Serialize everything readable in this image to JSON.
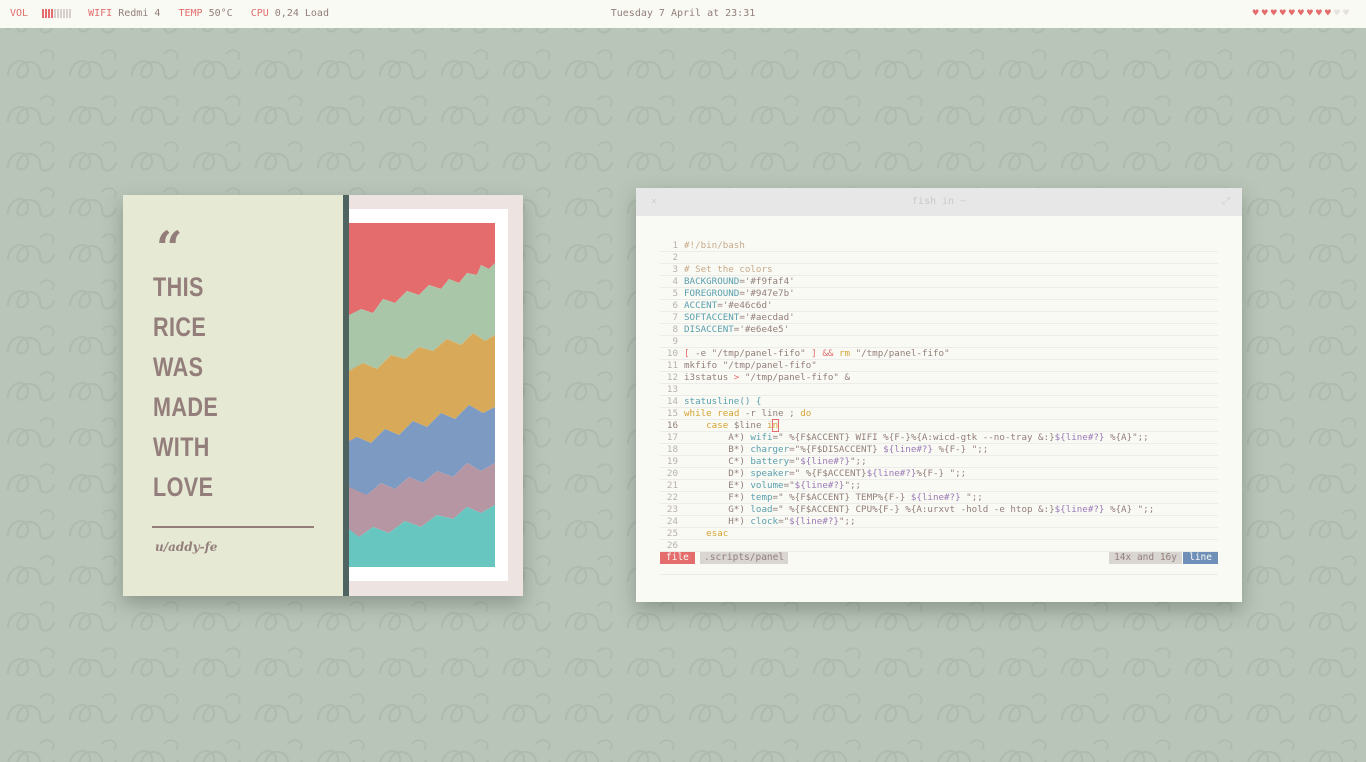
{
  "topbar": {
    "vol_label": "VOL",
    "volume_level": 0.4,
    "wifi_label": "WIFI",
    "wifi_value": "Redmi 4",
    "temp_label": "TEMP",
    "temp_value": "50°C",
    "cpu_label": "CPU",
    "cpu_value": "0,24 Load",
    "clock": "Tuesday 7 April at 23:31",
    "hearts_filled": 9,
    "hearts_total": 11,
    "heart_glyph": "♥"
  },
  "card": {
    "quote_glyph": "“",
    "words": [
      "THIS",
      "RICE",
      "WAS",
      "MADE",
      "WITH",
      "LOVE"
    ],
    "signature": "u/addy-fe",
    "stripe_colors": [
      "#e46c6d",
      "#a9c7a8",
      "#d9a95a",
      "#7c9ac2",
      "#b596a2",
      "#68c6c0"
    ]
  },
  "terminal": {
    "title": "fish in ~",
    "close_glyph": "✕",
    "maximize_glyph": "⤢",
    "lines": [
      {
        "n": "1",
        "t": "#!/bin/bash"
      },
      {
        "n": "2",
        "t": ""
      },
      {
        "n": "3",
        "t": "# Set the colors"
      },
      {
        "n": "4",
        "t": "BACKGROUND='#f9faf4'"
      },
      {
        "n": "5",
        "t": "FOREGROUND='#947e7b'"
      },
      {
        "n": "6",
        "t": "ACCENT='#e46c6d'"
      },
      {
        "n": "7",
        "t": "SOFTACCENT='#aecdad'"
      },
      {
        "n": "8",
        "t": "DISACCENT='#e6e4e5'"
      },
      {
        "n": "9",
        "t": ""
      },
      {
        "n": "10",
        "t": "[ -e \"/tmp/panel-fifo\" ] && rm \"/tmp/panel-fifo\""
      },
      {
        "n": "11",
        "t": "mkfifo \"/tmp/panel-fifo\""
      },
      {
        "n": "12",
        "t": "i3status > \"/tmp/panel-fifo\" &"
      },
      {
        "n": "13",
        "t": ""
      },
      {
        "n": "14",
        "t": "statusline() {"
      },
      {
        "n": "15",
        "t": "while read -r line ; do"
      },
      {
        "n": "16",
        "t": "    case $line in"
      },
      {
        "n": "17",
        "t": "        A*) wifi=\" %{F$ACCENT} WIFI %{F-}%{A:wicd-gtk --no-tray &:}${line#?} %{A}\";;"
      },
      {
        "n": "18",
        "t": "        B*) charger=\"%{F$DISACCENT} ${line#?} %{F-} \";;"
      },
      {
        "n": "19",
        "t": "        C*) battery=\"${line#?}\";;"
      },
      {
        "n": "20",
        "t": "        D*) speaker=\" %{F$ACCENT}${line#?}%{F-} \";;"
      },
      {
        "n": "21",
        "t": "        E*) volume=\"${line#?}\";;"
      },
      {
        "n": "22",
        "t": "        F*) temp=\" %{F$ACCENT} TEMP%{F-} ${line#?} \";;"
      },
      {
        "n": "23",
        "t": "        G*) load=\" %{F$ACCENT} CPU%{F-} %{A:urxvt -hold -e htop &:}${line#?} %{A} \";;"
      },
      {
        "n": "24",
        "t": "        H*) clock=\"${line#?}\";;"
      },
      {
        "n": "25",
        "t": "    esac"
      },
      {
        "n": "26",
        "t": ""
      }
    ],
    "status": {
      "file": "file",
      "path": ".scripts/panel",
      "position": "14x and 16y",
      "mode": "line"
    }
  },
  "colors": {
    "accent": "#e46c6d",
    "foreground": "#947e7b",
    "background": "#f9faf4",
    "desktop": "#b9c5b9"
  }
}
